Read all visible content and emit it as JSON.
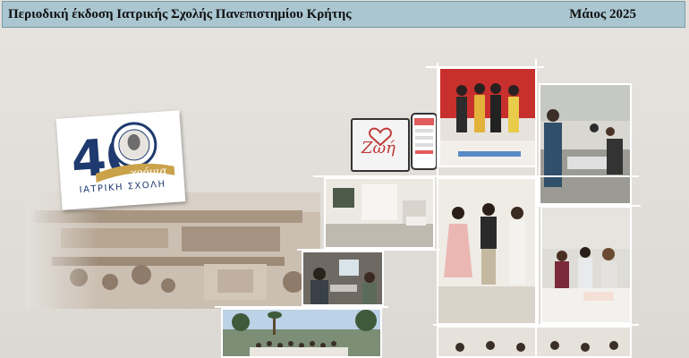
{
  "header": {
    "title": "Περιοδική έκδοση Ιατρικής Σχολής Πανεπιστημίου Κρήτης",
    "date": "Μάιος 2025"
  },
  "logo": {
    "number": "40",
    "script_word": "χρόνια",
    "school": "ΙΑΤΡΙΚΗ ΣΧΟΛΗ"
  },
  "app": {
    "name": "Ζωή"
  },
  "colors": {
    "header_bg": "#a9c6d1",
    "logo_blue": "#1e3a6e",
    "logo_gold": "#c9a24a",
    "page_bg": "#e3e0dc"
  }
}
